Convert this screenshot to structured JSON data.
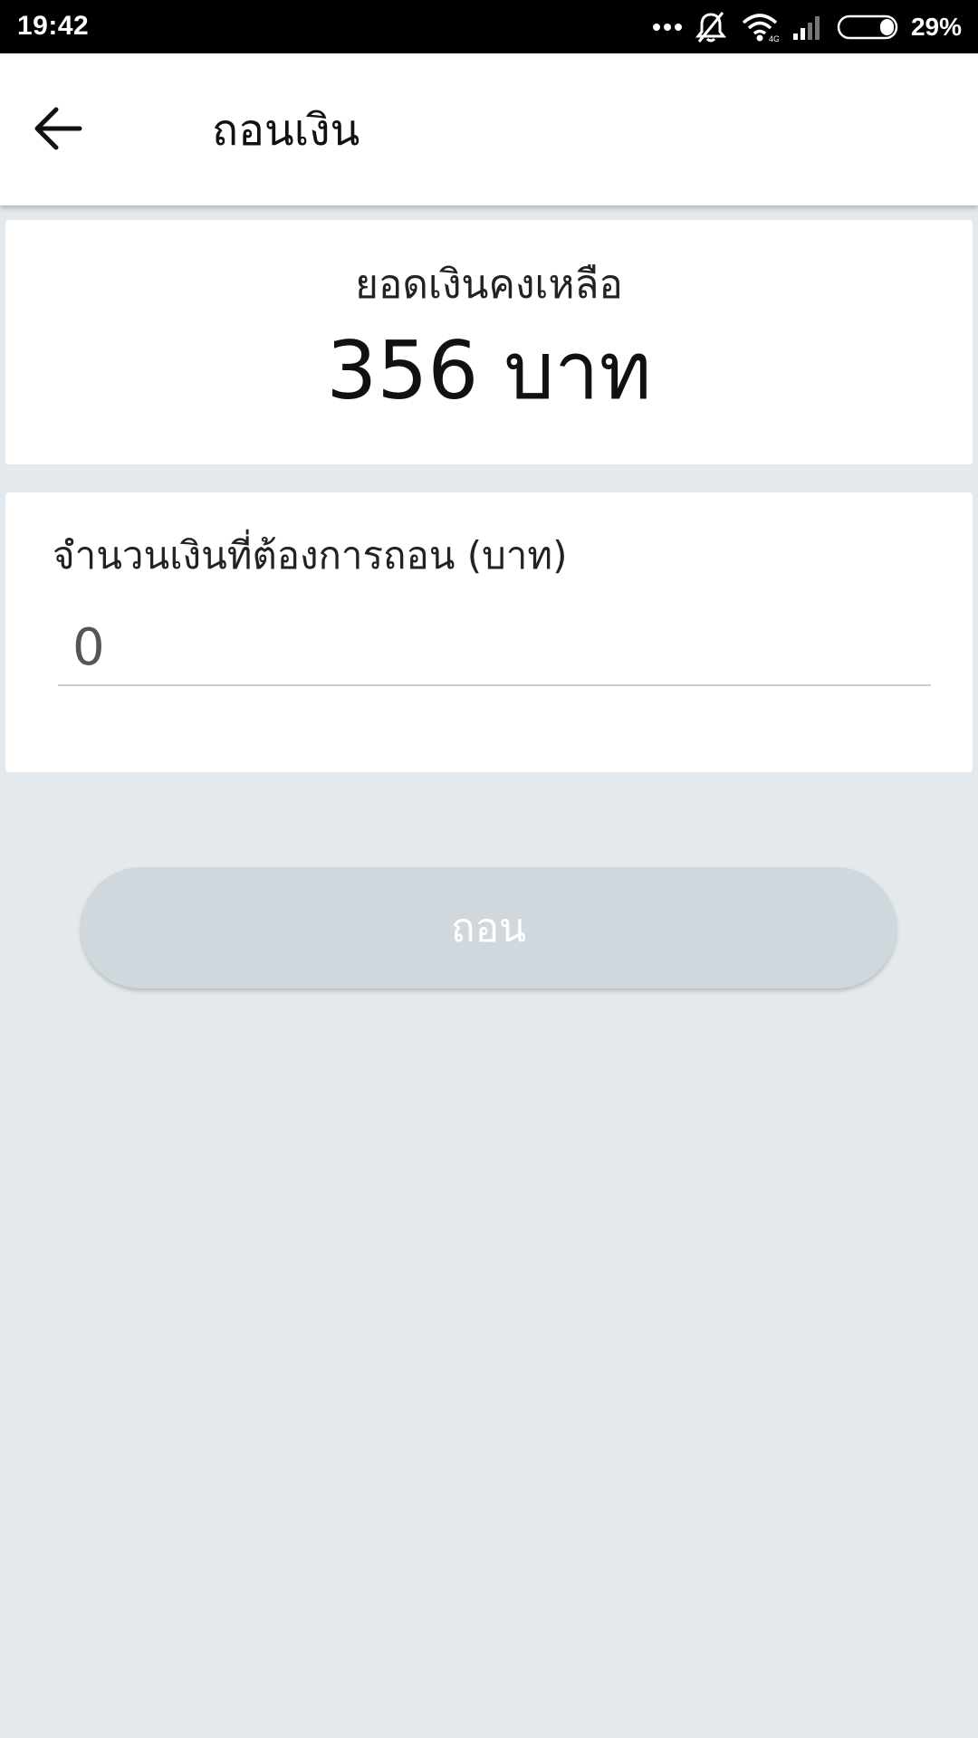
{
  "status_bar": {
    "time": "19:42",
    "battery_percent": "29%",
    "icons": [
      "more-dots-icon",
      "bell-off-icon",
      "wifi-icon",
      "cell-signal-icon",
      "battery-icon"
    ]
  },
  "app_bar": {
    "title": "ถอนเงิน",
    "back_icon": "arrow-left-icon"
  },
  "balance": {
    "label": "ยอดเงินคงเหลือ",
    "value": "356 บาท"
  },
  "amount": {
    "label": "จำนวนเงินที่ต้องการถอน (บาท)",
    "placeholder": "0"
  },
  "withdraw_button": {
    "label": "ถอน"
  },
  "colors": {
    "background": "#e3e9ec",
    "card": "#ffffff",
    "button_disabled": "#d0d8dd",
    "status_bar": "#000000"
  }
}
